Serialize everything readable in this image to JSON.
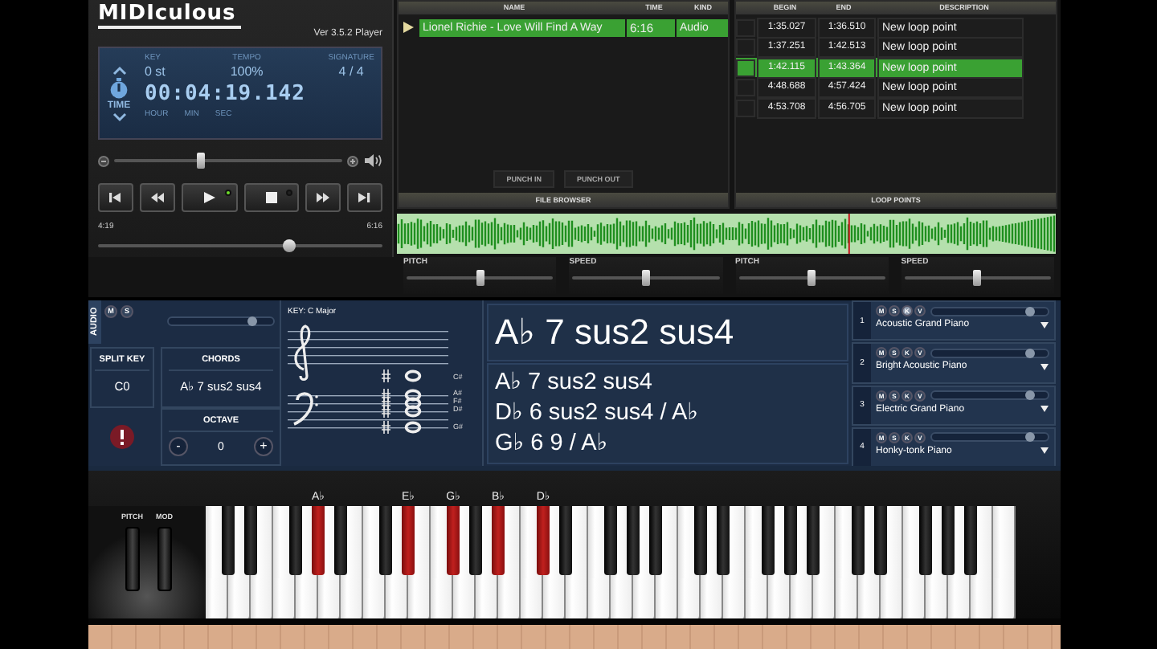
{
  "app": {
    "logo": "MIDIculous",
    "version": "Ver 3.5.2 Player"
  },
  "display": {
    "mode": "TIME",
    "fields": [
      {
        "label": "KEY",
        "value": "0 st"
      },
      {
        "label": "TEMPO",
        "value": "100%"
      },
      {
        "label": "SIGNATURE",
        "value": "4 / 4"
      }
    ],
    "time": "00:04:19.142",
    "units": [
      "HOUR",
      "MIN",
      "SEC"
    ]
  },
  "volume": {
    "level": 0.38
  },
  "transport": {
    "buttons": [
      {
        "kind": "start"
      },
      {
        "kind": "rewind"
      },
      {
        "kind": "play",
        "on": true
      },
      {
        "kind": "stop",
        "on": false
      },
      {
        "kind": "forward"
      },
      {
        "kind": "end"
      }
    ]
  },
  "position": {
    "elapsed": "4:19",
    "total": "6:16",
    "level": 0.67
  },
  "file_browser": {
    "title": "FILE BROWSER",
    "columns": [
      "NAME",
      "TIME",
      "KIND"
    ],
    "rows": [
      {
        "cells": [
          "Lionel Richie - Love Will Find A Way",
          "6:16",
          "Audio"
        ],
        "selected": true
      }
    ],
    "buttons": [
      "PUNCH IN",
      "PUNCH OUT"
    ]
  },
  "loop_points": {
    "title": "LOOP POINTS",
    "columns": [
      "BEGIN",
      "END",
      "DESCRIPTION"
    ],
    "rows": [
      {
        "cells": [
          "1:35.027",
          "1:36.510",
          "New loop point"
        ],
        "selected": false
      },
      {
        "cells": [
          "1:37.251",
          "1:42.513",
          "New loop point"
        ],
        "selected": false
      },
      {
        "cells": [
          "1:42.115",
          "1:43.364",
          "New loop point"
        ],
        "selected": true
      },
      {
        "cells": [
          "4:48.688",
          "4:57.424",
          "New loop point"
        ],
        "selected": false
      },
      {
        "cells": [
          "4:53.708",
          "4:56.705",
          "New loop point"
        ],
        "selected": false
      }
    ]
  },
  "waveform": {
    "level": 0.685
  },
  "sliders": [
    {
      "label": "PITCH",
      "level": 0.5
    },
    {
      "label": "SPEED",
      "level": 0.5
    },
    {
      "label": "PITCH",
      "level": 0.5
    },
    {
      "label": "SPEED",
      "level": 0.5
    }
  ],
  "audio": {
    "label": "AUDIO",
    "buttons": [
      "M",
      "S"
    ],
    "level": 0.8
  },
  "split_key": {
    "label": "SPLIT KEY",
    "value": "C0"
  },
  "chords": {
    "label": "CHORDS",
    "value": "A♭ 7 sus2 sus4"
  },
  "octave": {
    "label": "OCTAVE",
    "value": "0",
    "minus": "-",
    "plus": "+"
  },
  "staff": {
    "key": "KEY: C Major",
    "note_names": [
      "C#",
      "A#",
      "F#",
      "D#",
      "G#"
    ]
  },
  "chord_display": {
    "main": "A♭ 7 sus2 sus4",
    "alternatives": [
      "A♭ 7 sus2 sus4",
      "D♭ 6 sus2 sus4 / A♭",
      "G♭ 6 9 / A♭"
    ]
  },
  "tracks": [
    {
      "number": "1",
      "buttons": [
        {
          "label": "M",
          "on": false
        },
        {
          "label": "S",
          "on": false
        },
        {
          "label": "K",
          "on": true
        },
        {
          "label": "V",
          "on": false
        }
      ],
      "level": 0.85,
      "instrument": "Acoustic Grand Piano"
    },
    {
      "number": "2",
      "buttons": [
        {
          "label": "M",
          "on": false
        },
        {
          "label": "S",
          "on": false
        },
        {
          "label": "K",
          "on": false
        },
        {
          "label": "V",
          "on": false
        }
      ],
      "level": 0.85,
      "instrument": "Bright Acoustic Piano"
    },
    {
      "number": "3",
      "buttons": [
        {
          "label": "M",
          "on": false
        },
        {
          "label": "S",
          "on": false
        },
        {
          "label": "K",
          "on": false
        },
        {
          "label": "V",
          "on": false
        }
      ],
      "level": 0.85,
      "instrument": "Electric Grand Piano"
    },
    {
      "number": "4",
      "buttons": [
        {
          "label": "M",
          "on": false
        },
        {
          "label": "S",
          "on": false
        },
        {
          "label": "K",
          "on": false
        },
        {
          "label": "V",
          "on": false
        }
      ],
      "level": 0.85,
      "instrument": "Honky-tonk Piano"
    }
  ],
  "keyboard": {
    "wheels": [
      {
        "label": "PITCH"
      },
      {
        "label": "MOD"
      }
    ],
    "keys": [
      {
        "kind": "white",
        "pressed": false
      },
      {
        "kind": "black",
        "pressed": false
      },
      {
        "kind": "white",
        "pressed": false
      },
      {
        "kind": "black",
        "pressed": false
      },
      {
        "kind": "white",
        "pressed": false
      },
      {
        "kind": "white",
        "pressed": false
      },
      {
        "kind": "black",
        "pressed": false
      },
      {
        "kind": "white",
        "pressed": false
      },
      {
        "kind": "black",
        "pressed": true,
        "label": "A♭"
      },
      {
        "kind": "white",
        "pressed": false
      },
      {
        "kind": "black",
        "pressed": false
      },
      {
        "kind": "white",
        "pressed": false
      },
      {
        "kind": "white",
        "pressed": false
      },
      {
        "kind": "black",
        "pressed": false
      },
      {
        "kind": "white",
        "pressed": false
      },
      {
        "kind": "black",
        "pressed": true,
        "label": "E♭"
      },
      {
        "kind": "white",
        "pressed": false
      },
      {
        "kind": "white",
        "pressed": false
      },
      {
        "kind": "black",
        "pressed": true,
        "label": "G♭"
      },
      {
        "kind": "white",
        "pressed": false
      },
      {
        "kind": "black",
        "pressed": false
      },
      {
        "kind": "white",
        "pressed": false
      },
      {
        "kind": "black",
        "pressed": true,
        "label": "B♭"
      },
      {
        "kind": "white",
        "pressed": false
      },
      {
        "kind": "white",
        "pressed": false
      },
      {
        "kind": "black",
        "pressed": true,
        "label": "D♭"
      },
      {
        "kind": "white",
        "pressed": false
      },
      {
        "kind": "black",
        "pressed": false
      },
      {
        "kind": "white",
        "pressed": false
      },
      {
        "kind": "white",
        "pressed": false
      },
      {
        "kind": "black",
        "pressed": false
      },
      {
        "kind": "white",
        "pressed": false
      },
      {
        "kind": "black",
        "pressed": false
      },
      {
        "kind": "white",
        "pressed": false
      },
      {
        "kind": "black",
        "pressed": false
      },
      {
        "kind": "white",
        "pressed": false
      },
      {
        "kind": "white",
        "pressed": false
      },
      {
        "kind": "black",
        "pressed": false
      },
      {
        "kind": "white",
        "pressed": false
      },
      {
        "kind": "black",
        "pressed": false
      },
      {
        "kind": "white",
        "pressed": false
      },
      {
        "kind": "white",
        "pressed": false
      },
      {
        "kind": "black",
        "pressed": false
      },
      {
        "kind": "white",
        "pressed": false
      },
      {
        "kind": "black",
        "pressed": false
      },
      {
        "kind": "white",
        "pressed": false
      },
      {
        "kind": "black",
        "pressed": false
      },
      {
        "kind": "white",
        "pressed": false
      },
      {
        "kind": "white",
        "pressed": false
      },
      {
        "kind": "black",
        "pressed": false
      },
      {
        "kind": "white",
        "pressed": false
      },
      {
        "kind": "black",
        "pressed": false
      },
      {
        "kind": "white",
        "pressed": false
      },
      {
        "kind": "white",
        "pressed": false
      },
      {
        "kind": "black",
        "pressed": false
      },
      {
        "kind": "white",
        "pressed": false
      },
      {
        "kind": "black",
        "pressed": false
      },
      {
        "kind": "white",
        "pressed": false
      },
      {
        "kind": "black",
        "pressed": false
      },
      {
        "kind": "white",
        "pressed": false
      },
      {
        "kind": "white",
        "pressed": false
      }
    ]
  }
}
